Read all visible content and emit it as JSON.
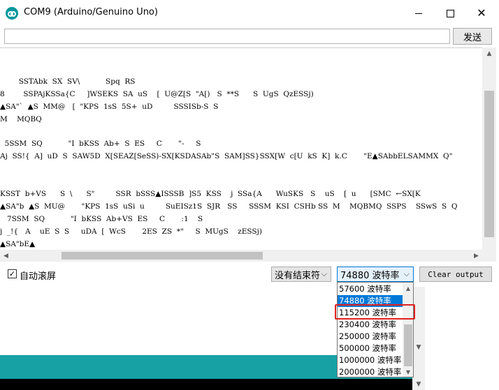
{
  "window": {
    "title": "COM9 (Arduino/Genuino Uno)",
    "minimize_label": "—",
    "close_label": "✕"
  },
  "input": {
    "value": "",
    "send_label": "发送"
  },
  "output": {
    "lines": [
      "",
      "        SSTAbk  SX  SV\\           Spq  RS",
      "8        SSPAjKSSa{C     ]WSEKS  SA  uS    [  U@Z[S  \"A[)   S  **S      S  UgS  QzESSj)",
      "▲SA\"`  ▲S  MM@   [  \"KPS  1sS  5S+  uD         SSSISb-S  S",
      "M    MQBQ",
      "",
      "  5SSM  SQ           \"I  bKSS  Ab+  S  ES     C       \"-     S",
      "Aj  SS!{  A]  uD  S  SAW5D  X[SEAZ[SeSS)-SX[KSDASAb\"S  SAM]SS}SSX[W  c[U  kS  K]  k.C       \"E▲SAbbELSAMMX  Q\"",
      "",
      "",
      "KSST  b+VS      S  \\      S\"         SSR  bSSS▲ISSSB  ]S5  KSS    j  SSa{A      WuSKS   S    uS    [  u      [SMC  ←SX[K",
      "▲SA\"b  ▲S  MU@       \"KPS  1sS  uSi  u         SuEISz1S  SJR   SS     SSSM  KSI  CSHb SS  M    MQBMQ  SSPS    SSwS  S  Q",
      "   7SSM  SQ           \"I  bKSS  Ab+VS  ES     C       :1    S",
      "j  _!{   A    uE  S  S     uDA  [  WcS       2ES  ZS  *\"     S  MUgS    zESSj)",
      "▲SA\"bE▲"
    ]
  },
  "controls": {
    "autoscroll_label": "自动滚屏",
    "autoscroll_checked": "✓",
    "line_ending_value": "没有结束符",
    "baud_value": "74880 波特率",
    "clear_label": "Clear output"
  },
  "dropdown": {
    "options": [
      "57600 波特率",
      "74880 波特率",
      "115200 波特率",
      "230400 波特率",
      "250000 波特率",
      "500000 波特率",
      "1000000 波特率",
      "2000000 波特率"
    ],
    "selected_index": 1,
    "highlighted_option": "115200 波特率"
  },
  "colors": {
    "selection": "#0078d7",
    "highlight_border": "#e02020",
    "teal": "#17a1a5"
  },
  "icons": {
    "app": "arduino-icon",
    "chevron": "chevron-down-icon"
  }
}
